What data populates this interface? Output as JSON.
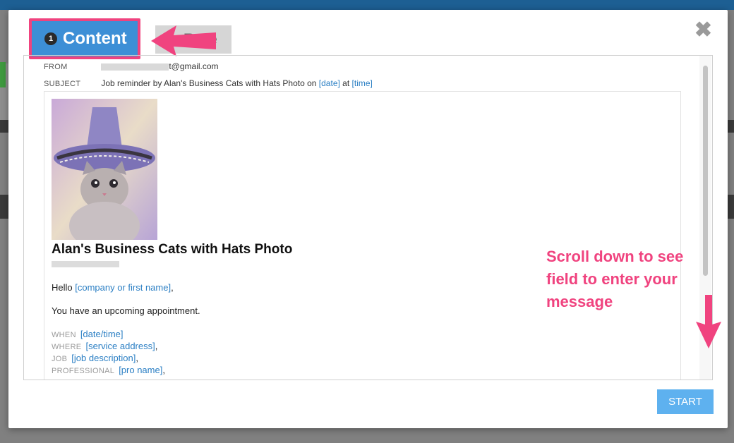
{
  "modal": {
    "close_symbol": "✖",
    "tabs": [
      {
        "number": "1",
        "label": "Content",
        "active": true
      },
      {
        "label": "Rule",
        "active": false
      }
    ],
    "start_button": "START"
  },
  "email": {
    "from_label": "FROM",
    "from_value": "t@gmail.com",
    "subject_label": "SUBJECT",
    "subject_prefix": "Job reminder by Alan's Business Cats with Hats Photo on",
    "subject_date_token": "[date]",
    "subject_at": "at",
    "subject_time_token": "[time]",
    "business_name": "Alan's Business Cats with Hats Photo",
    "greeting": "Hello",
    "greeting_token": "[company or first name]",
    "greeting_comma": ",",
    "body_text": "You have an upcoming appointment.",
    "details": [
      {
        "label": "WHEN",
        "token": "[date/time]",
        "suffix": ""
      },
      {
        "label": "WHERE",
        "token": "[service address]",
        "suffix": ","
      },
      {
        "label": "JOB",
        "token": "[job description]",
        "suffix": ","
      },
      {
        "label": "PROFESSIONAL",
        "token": "[pro name]",
        "suffix": ","
      }
    ]
  },
  "annotation": {
    "text": "Scroll down to see field to enter your message"
  },
  "colors": {
    "accent_blue": "#3d8fd6",
    "highlight_pink": "#f0437f",
    "link_blue": "#2b7fc4",
    "start_blue": "#5eb1ef"
  }
}
